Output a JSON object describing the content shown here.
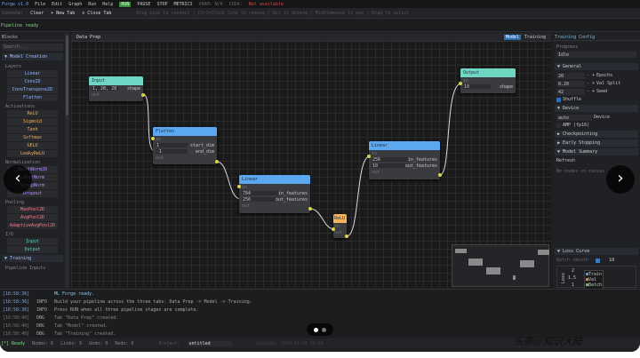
{
  "menubar": {
    "app": "Forge v1.0",
    "items": [
      "File",
      "Edit",
      "Graph",
      "Run",
      "Help"
    ],
    "run": "RUN",
    "pause": "PAUSE",
    "stop": "STOP",
    "metrics": "METRICS",
    "vram": "VRAM: N/A",
    "cuda": "CUDA:",
    "cuda_status": "Not available"
  },
  "toolbar": {
    "label": "Console:",
    "clear": "Clear",
    "new_tab": "+ New Tab",
    "close_tab": "x Close Tab",
    "hint": "Drag pins to connect | Ctrl+Click link to remove | Del to delete | Middlemouse to pan | Drag to select"
  },
  "status": "Pipeline ready",
  "blocks": {
    "title": "Blocks",
    "search_placeholder": "Search...",
    "section": "▼ Model Creation",
    "layers_label": "Layers",
    "layers": [
      "Linear",
      "Conv2D",
      "ConvTranspose2D",
      "Flatten"
    ],
    "act_label": "Activations",
    "acts": [
      "ReLU",
      "Sigmoid",
      "Tanh",
      "Softmax",
      "GELU",
      "LeakyReLU"
    ],
    "norm_label": "Normalization",
    "norms": [
      "BatchNorm2D",
      "LayerNorm",
      "GroupNorm",
      "Dropout"
    ],
    "pool_label": "Pooling",
    "pools": [
      "MaxPool2D",
      "AvgPool2D",
      "AdaptiveAvgPool2D"
    ],
    "io_label": "I/O",
    "io": [
      "Input",
      "Output"
    ],
    "training": "▼ Training",
    "pipeline_inputs": "Pipeline Inputs"
  },
  "canvas": {
    "title": "Data Prep",
    "tabs": [
      "Model",
      "Training"
    ],
    "nodes": {
      "input": {
        "title": "Input",
        "value": "1, 28, 28",
        "param": "shape",
        "out": "out"
      },
      "flatten": {
        "title": "Flatten",
        "in": "in",
        "v1": "1",
        "p1": "start_dim",
        "v2": "-1",
        "p2": "end_dim",
        "out": "out"
      },
      "linear1": {
        "title": "Linear",
        "in": "in",
        "v1": "784",
        "p1": "in_features",
        "v2": "256",
        "p2": "out_features",
        "out": "out"
      },
      "relu": {
        "title": "ReLU",
        "in": "in",
        "out": "out"
      },
      "linear2": {
        "title": "Linear",
        "in": "in",
        "v1": "256",
        "p1": "in_features",
        "v2": "10",
        "p2": "out_features",
        "out": "out"
      },
      "output": {
        "title": "Output",
        "in": "in",
        "value": "10",
        "param": "shape"
      }
    }
  },
  "config": {
    "title": "Training Config",
    "progress_label": "Progress",
    "progress": "Idle",
    "general": "▼ General",
    "epochs": "20",
    "epochs_label": "Epochs",
    "val": "0.20",
    "val_label": "Val Split",
    "seed": "42",
    "seed_label": "Seed",
    "shuffle": "Shuffle",
    "device_sect": "▼ Device",
    "device": "auto",
    "device_label": "Device",
    "amp": "AMP (fp16)",
    "checkpointing": "▶ Checkpointing",
    "early": "▶ Early Stopping",
    "summary": "▼ Model Summary",
    "refresh": "Refresh",
    "no_nodes": "No nodes on canvas",
    "loss": "▼ Loss Curve",
    "batch_label": "Batch smooth",
    "batch": "10",
    "legend": [
      "Train",
      "Val",
      "Batch"
    ],
    "yticks": [
      "2",
      "1.5",
      "1"
    ],
    "ylabel": "Loss"
  },
  "log": [
    {
      "ts": "[16:58:36]",
      "lv": "",
      "msg": "ML Forge ready.",
      "kind": "hi"
    },
    {
      "ts": "[16:58:36]",
      "lv": "INFO",
      "msg": "Build your pipeline across the three tabs: Data Prep -> Model -> Training.",
      "kind": "info"
    },
    {
      "ts": "[16:58:36]",
      "lv": "INFO",
      "msg": "Press RUN when all three pipeline stages are complete.",
      "kind": "info"
    },
    {
      "ts": "[16:58:40]",
      "lv": "DBG",
      "msg": "Tab \"Data Prep\" created.",
      "kind": "dbg"
    },
    {
      "ts": "[16:58:40]",
      "lv": "DBG",
      "msg": "Tab \"Model\" created.",
      "kind": "dbg"
    },
    {
      "ts": "[16:58:40]",
      "lv": "DBG",
      "msg": "Tab \"Training\" created.",
      "kind": "dbg"
    }
  ],
  "statusbar": {
    "ready": "[*] Ready",
    "nodes": "Nodes: 6",
    "links": "Links: 5",
    "undo": "Undo: 0",
    "redo": "Redo: 0",
    "project_label": "Project:",
    "project": "untitled",
    "session": "Session: 2026-03-18 16:58"
  },
  "watermark": "头条@知识大陆"
}
